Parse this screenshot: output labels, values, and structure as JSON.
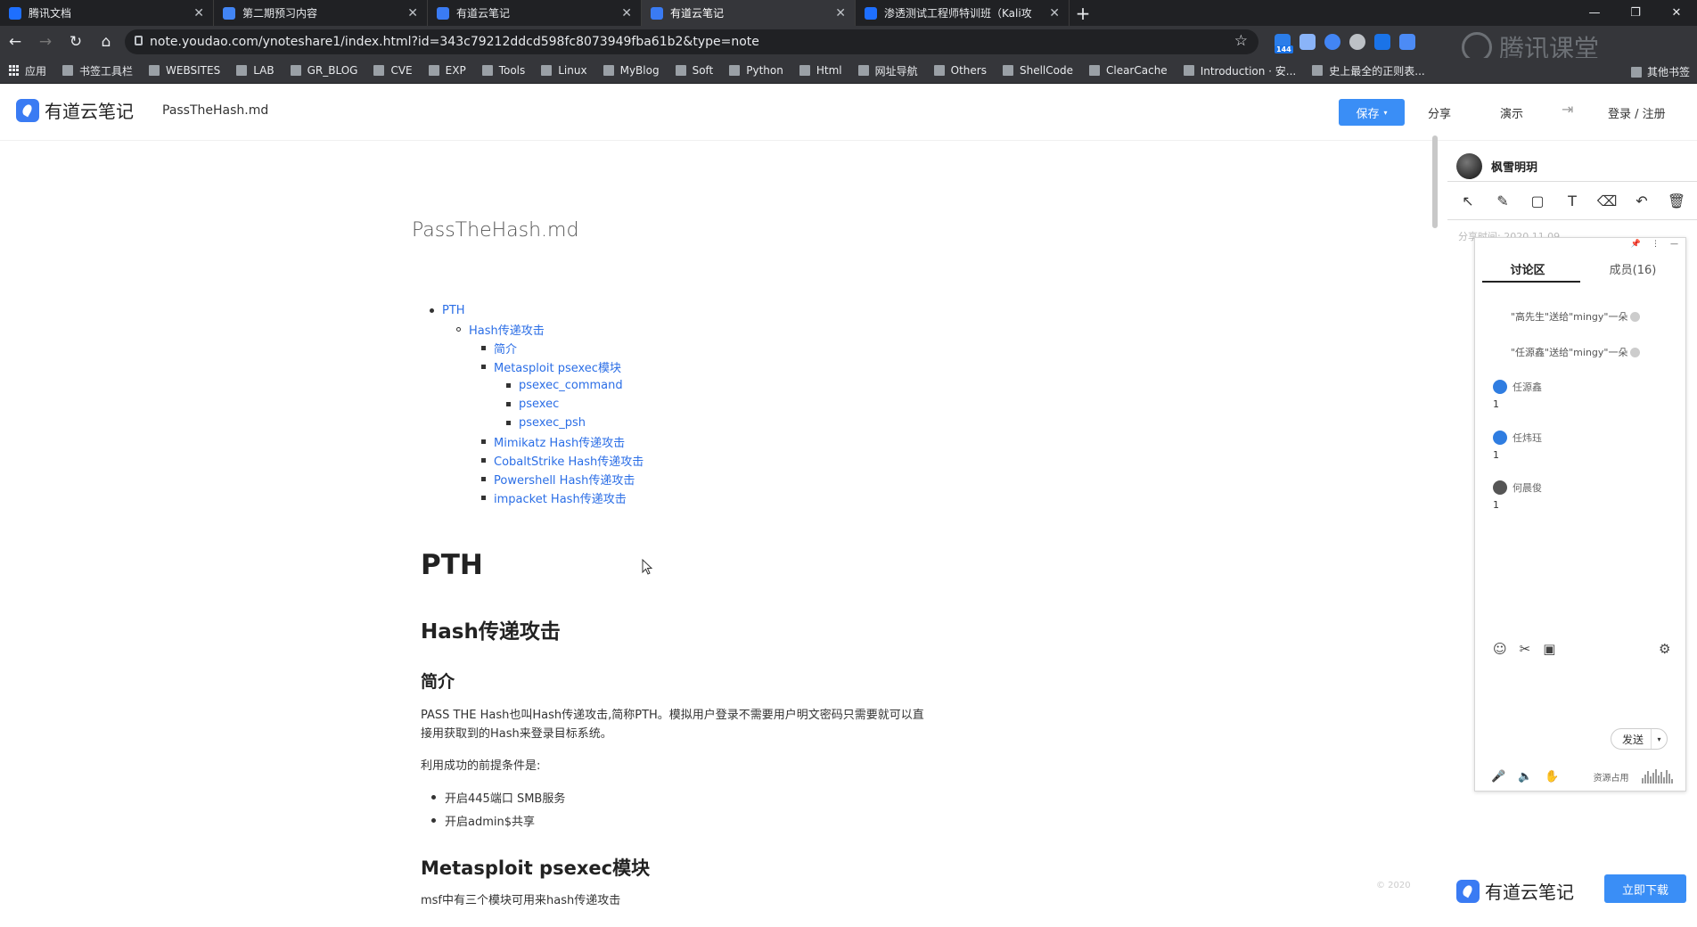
{
  "browser": {
    "tabs": [
      {
        "label": "腾讯文档",
        "icon": "tencent-docs-icon",
        "color": "#1e6fff"
      },
      {
        "label": "第二期预习内容",
        "icon": "doc-icon",
        "color": "#4285f4"
      },
      {
        "label": "有道云笔记",
        "icon": "youdao-note-icon",
        "color": "#3a7bf3"
      },
      {
        "label": "有道云笔记",
        "icon": "youdao-note-icon",
        "color": "#3a7bf3"
      },
      {
        "label": "渗透测试工程师特训班（Kali攻",
        "icon": "course-icon",
        "color": "#1e6fff"
      }
    ],
    "active_tab": 3,
    "url": "note.youdao.com/ynoteshare1/index.html?id=343c79212ddcd598fc8073949fba61b2&type=note",
    "extension_badge": "144",
    "watermark": "腾讯课堂",
    "bookmarks": [
      "应用",
      "书签工具栏",
      "WEBSITES",
      "LAB",
      "GR_BLOG",
      "CVE",
      "EXP",
      "Tools",
      "Linux",
      "MyBlog",
      "Soft",
      "Python",
      "Html",
      "网址导航",
      "Others",
      "ShellCode",
      "ClearCache",
      "Introduction · 安...",
      "史上最全的正则表..."
    ],
    "other_bookmarks": "其他书签"
  },
  "app": {
    "logo": "有道云笔记",
    "doc_name": "PassTheHash.md",
    "save": "保存",
    "share": "分享",
    "present": "演示",
    "login": "登录 / 注册"
  },
  "doc": {
    "title": "PassTheHash.md",
    "toc": [
      {
        "level": 0,
        "text": "PTH"
      },
      {
        "level": 1,
        "text": "Hash传递攻击"
      },
      {
        "level": 2,
        "text": "简介"
      },
      {
        "level": 2,
        "text": "Metasploit psexec模块"
      },
      {
        "level": 3,
        "text": "psexec_command"
      },
      {
        "level": 3,
        "text": "psexec"
      },
      {
        "level": 3,
        "text": "psexec_psh"
      },
      {
        "level": 2,
        "text": "Mimikatz Hash传递攻击"
      },
      {
        "level": 2,
        "text": "CobaltStrike Hash传递攻击"
      },
      {
        "level": 2,
        "text": "Powershell Hash传递攻击"
      },
      {
        "level": 2,
        "text": "impacket Hash传递攻击"
      }
    ],
    "h1": "PTH",
    "h2": "Hash传递攻击",
    "h3": "简介",
    "para1_line1": "PASS THE Hash也叫Hash传递攻击,简称PTH。模拟用户登录不需要用户明文密码只需要就可以直",
    "para1_line2": "接用获取到的Hash来登录目标系统。",
    "para2": "利用成功的前提条件是:",
    "conditions": [
      "开启445端口 SMB服务",
      "开启admin$共享"
    ],
    "h2_metasploit": "Metasploit psexec模块",
    "para3": "msf中有三个模块可用来hash传递攻击"
  },
  "panel": {
    "username": "枫雪明玥",
    "share_time": "分享时间: 2020.11.09",
    "tabs": [
      "讨论区",
      "成员(16)"
    ],
    "system_messages": [
      "\"高先生\"送给\"mingy\"一朵",
      "\"任源鑫\"送给\"mingy\"一朵"
    ],
    "messages": [
      {
        "name": "任源鑫",
        "text": "1"
      },
      {
        "name": "任炜珏",
        "text": "1"
      },
      {
        "name": "何晨俊",
        "text": "1"
      }
    ],
    "send": "发送",
    "bandwidth": "资源占用"
  },
  "footer": {
    "logo": "有道云笔记",
    "button": "立即下载",
    "faint": "© 2020"
  }
}
